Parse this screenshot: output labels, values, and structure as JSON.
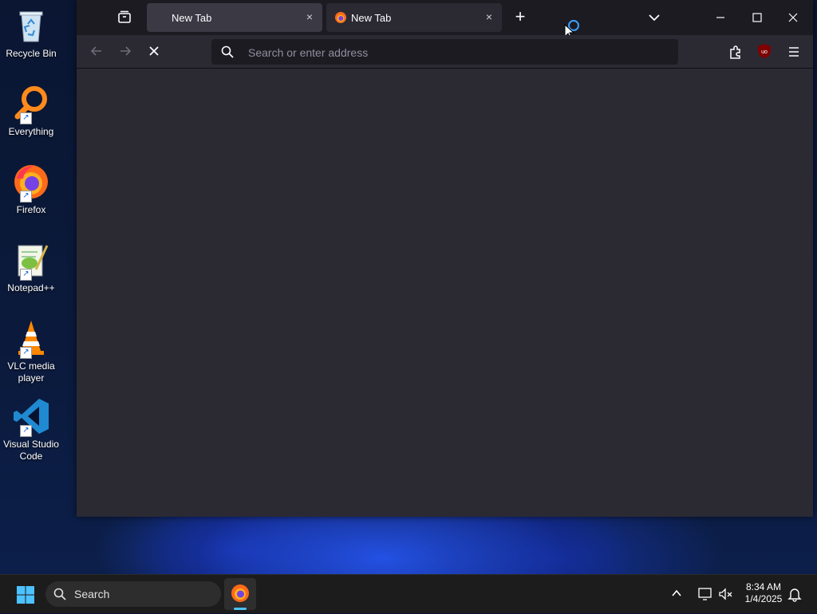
{
  "desktop": {
    "icons": [
      {
        "label": "Recycle Bin",
        "icon": "recycle-bin-icon"
      },
      {
        "label": "Everything",
        "icon": "everything-search-icon"
      },
      {
        "label": "Firefox",
        "icon": "firefox-icon"
      },
      {
        "label": "Notepad++",
        "icon": "notepad-plus-plus-icon"
      },
      {
        "label": "VLC media player",
        "icon": "vlc-icon"
      },
      {
        "label": "Visual Studio Code",
        "icon": "vscode-icon"
      }
    ]
  },
  "browser": {
    "tabs": [
      {
        "title": "New Tab",
        "active": true,
        "close_symbol": "×"
      },
      {
        "title": "New Tab",
        "active": false,
        "close_symbol": "×"
      }
    ],
    "new_tab_symbol": "+",
    "urlbar": {
      "placeholder": "Search or enter address",
      "value": ""
    },
    "colors": {
      "frame": "#1c1b22",
      "toolbar": "#2b2a33",
      "active_tab": "#3a3944",
      "text": "#fbfbfe"
    }
  },
  "taskbar": {
    "search_label": "Search",
    "time": "8:34 AM",
    "date": "1/4/2025",
    "colors": {
      "accent": "#4cc2ff",
      "background": "#1c1c1c"
    }
  }
}
